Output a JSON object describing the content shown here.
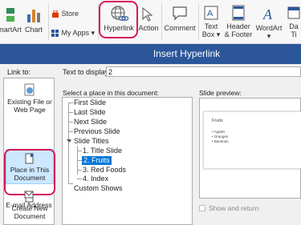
{
  "ribbon": {
    "smartart_label": "SmartArt",
    "chart_label": "Chart",
    "store_label": "Store",
    "myapps_label": "My Apps",
    "hyperlink_label": "Hyperlink",
    "action_label": "Action",
    "comment_label": "Comment",
    "textbox_label_1": "Text",
    "textbox_label_2": "Box",
    "headerfooter_label_1": "Header",
    "headerfooter_label_2": "& Footer",
    "wordart_label": "WordArt",
    "datetime_label_1": "Da",
    "datetime_label_2": "Ti",
    "accent_color": "#d6175a"
  },
  "dialog": {
    "title": "Insert Hyperlink",
    "link_to_label": "Link to:",
    "link_to_items": [
      {
        "line1": "Existing File or",
        "line2": "Web Page"
      },
      {
        "line1": "Place in This",
        "line2": "Document"
      },
      {
        "line1": "Create New",
        "line2": "Document"
      },
      {
        "line1": "E-mail Address",
        "line2": ""
      }
    ],
    "text_to_display_label": "Text to display:",
    "text_to_display_value": "2",
    "select_place_label": "Select a place in this document:",
    "tree": {
      "first_slide": "First Slide",
      "last_slide": "Last Slide",
      "next_slide": "Next Slide",
      "previous_slide": "Previous Slide",
      "slide_titles": "Slide Titles",
      "slides": [
        "1. Title Slide",
        "2. Fruits",
        "3. Red Foods",
        "4. Index"
      ],
      "custom_shows": "Custom Shows"
    },
    "slide_preview_label": "Slide preview:",
    "preview": {
      "title": "Fruits",
      "bullets": [
        "• Apples",
        "• Oranges",
        "• Bananas"
      ]
    },
    "show_and_return_label": "Show and return",
    "title_bar_color": "#2b579a",
    "selection_color": "#0078d7"
  }
}
